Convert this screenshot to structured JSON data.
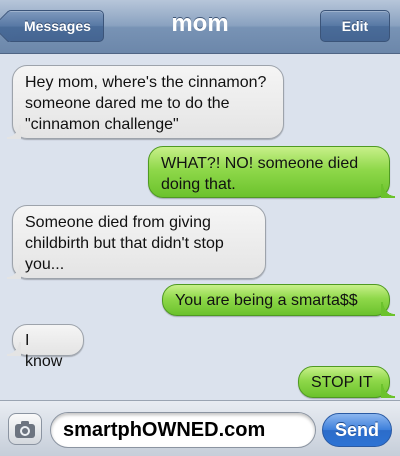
{
  "navbar": {
    "back_label": "Messages",
    "title": "mom",
    "edit_label": "Edit"
  },
  "messages": [
    {
      "sender": "them",
      "text": "Hey mom, where's the cinnamon? someone dared me to do the \"cinnamon challenge\""
    },
    {
      "sender": "me",
      "text": "WHAT?! NO! someone died doing that."
    },
    {
      "sender": "them",
      "text": "Someone died from giving childbirth but that didn't stop you..."
    },
    {
      "sender": "me",
      "text": "You are being a smarta$$"
    },
    {
      "sender": "them",
      "text": "I know"
    },
    {
      "sender": "me",
      "text": "STOP IT"
    }
  ],
  "input": {
    "camera_icon": "camera-icon",
    "value": "smartphOWNED.com",
    "send_label": "Send"
  },
  "colors": {
    "sent_bubble": "#8fd84a",
    "received_bubble": "#e8e8e8",
    "background": "#dbe2ed",
    "send_button": "#3d7fdb"
  }
}
